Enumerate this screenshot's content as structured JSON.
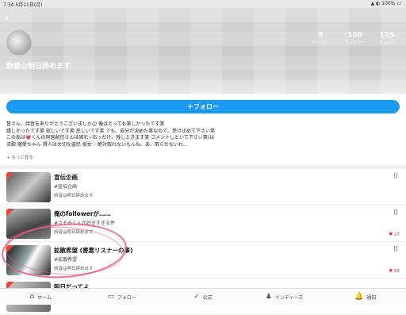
{
  "status": {
    "time": "7:34",
    "date": "5月11日(月)",
    "battery": "100%"
  },
  "header": {
    "name": "詩音@明日辞めます",
    "stats": [
      {
        "value": "5",
        "label": "ストーリー"
      },
      {
        "value": "100",
        "label": "フォロワー"
      },
      {
        "value": "175",
        "label": "フォロー"
      }
    ]
  },
  "follow_button": "＋フォロー",
  "bio": [
    "皆さん、詩音をありがとうございました😊 俺はとっても楽しかったです笑",
    "嬉しかったです笑 寂しいです笑 悲しいです笑 でも、自分が決めた事なので、受け止めて下さい笑",
    "この垢は💗くんの同居配信さんは固れ~右ッだけ、残しときます笑 コメントしといて下さい笑(は",
    "流歌 瑠愛ちゃん 賢人は大切な盗民 俊女♡ 絶対取れないもんね。あ、取らせないわ…"
  ],
  "more_label": "+ もっと見る",
  "items": [
    {
      "title": "宣伝企画",
      "tag": "#宣伝企画",
      "author": "詩音@明日辞めます",
      "likes": ""
    },
    {
      "title": "俺のfollowerが……",
      "tag": "#さそみくんが好きすぎる件",
      "author": "詩音@明日辞めます",
      "likes": "♥ 27"
    },
    {
      "title": "拡散希望 (害悪リスナーの事)",
      "tag": "#拡散希望",
      "author": "詩音@明日辞めます",
      "likes": "♥ 55"
    },
    {
      "title": "明日だってよ",
      "tag": "",
      "author": "",
      "likes": ""
    }
  ],
  "tabs": [
    {
      "label": "ホーム",
      "icon": "home-icon"
    },
    {
      "label": "フォロー",
      "icon": "follow-icon"
    },
    {
      "label": "公式",
      "icon": "check-icon"
    },
    {
      "label": "インディーズ",
      "icon": "indies-icon"
    },
    {
      "label": "通知",
      "icon": "bell-icon"
    }
  ]
}
